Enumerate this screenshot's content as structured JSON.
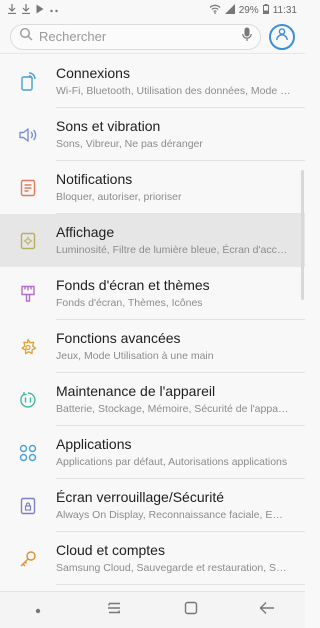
{
  "status_bar": {
    "battery": "29%",
    "time": "11:31"
  },
  "search": {
    "placeholder": "Rechercher"
  },
  "settings": [
    {
      "title": "Connexions",
      "subtitle": "Wi-Fi, Bluetooth, Utilisation des données, Mode Hors-ligne",
      "icon": "connections-icon"
    },
    {
      "title": "Sons et vibration",
      "subtitle": "Sons, Vibreur, Ne pas déranger",
      "icon": "sound-icon"
    },
    {
      "title": "Notifications",
      "subtitle": "Bloquer, autoriser, prioriser",
      "icon": "notifications-icon"
    },
    {
      "title": "Affichage",
      "subtitle": "Luminosité, Filtre de lumière bleue, Écran d'accueil",
      "icon": "display-icon"
    },
    {
      "title": "Fonds d'écran et thèmes",
      "subtitle": "Fonds d'écran, Thèmes, Icônes",
      "icon": "wallpaper-icon"
    },
    {
      "title": "Fonctions avancées",
      "subtitle": "Jeux, Mode Utilisation à une main",
      "icon": "advanced-features-icon"
    },
    {
      "title": "Maintenance de l'appareil",
      "subtitle": "Batterie, Stockage, Mémoire, Sécurité de l'appareil",
      "icon": "device-maintenance-icon"
    },
    {
      "title": "Applications",
      "subtitle": "Applications par défaut, Autorisations applications",
      "icon": "apps-icon"
    },
    {
      "title": "Écran verrouillage/Sécurité",
      "subtitle": "Always On Display, Reconnaissance faciale, Empreintes",
      "icon": "lock-icon"
    },
    {
      "title": "Cloud et comptes",
      "subtitle": "Samsung Cloud, Sauvegarde et restauration, Smart Switch",
      "icon": "key-icon"
    }
  ],
  "colors": {
    "accent": "#3b8fd8",
    "connections": "#4a9ed8",
    "sound": "#7a8ed8",
    "notifications": "#e07a5a",
    "display": "#b8b060",
    "wallpaper": "#b070c8",
    "advanced": "#e0a030",
    "maintenance": "#40b8a0",
    "apps": "#4aa0d8",
    "lock": "#8080c8",
    "cloud": "#e09030"
  }
}
